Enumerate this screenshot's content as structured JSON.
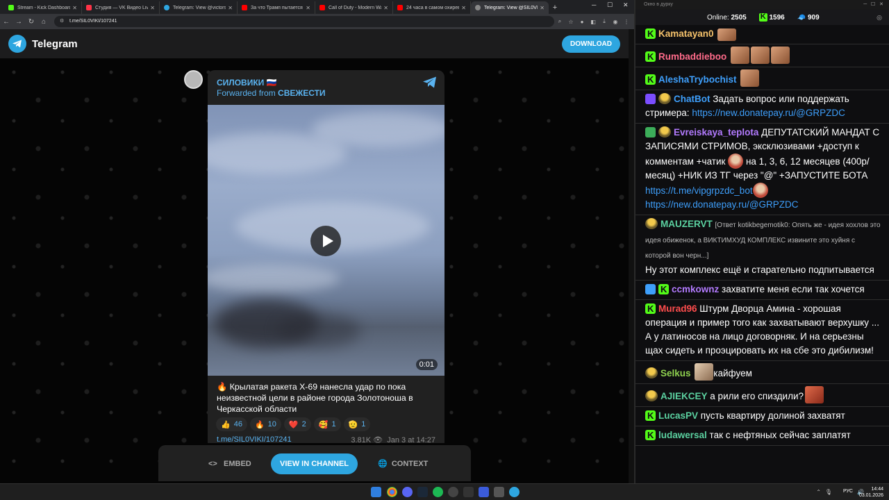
{
  "browser": {
    "tabs": [
      {
        "title": "Stream - Kick Dashboard",
        "icon": "kick-icon",
        "color": "#53fc18",
        "active": false
      },
      {
        "title": "Студия — VK Видео Live",
        "icon": "vk-video-icon",
        "color": "#ff3347",
        "active": false
      },
      {
        "title": "Telegram: View @victorstep…",
        "icon": "telegram-icon",
        "color": "#2ea6e0",
        "active": false
      },
      {
        "title": "За что Трамп пытается уби…",
        "icon": "youtube-icon",
        "color": "#ff0000",
        "active": false
      },
      {
        "title": "Call of Duty - Modern Warfa…",
        "icon": "youtube-icon",
        "color": "#ff0000",
        "active": false
      },
      {
        "title": "24 часа в самом охиревш…",
        "icon": "youtube-icon",
        "color": "#ff0000",
        "active": false
      },
      {
        "title": "Telegram: View @SIL0VIKI",
        "icon": "telegram-icon",
        "color": "#2ea6e0",
        "active": true
      }
    ],
    "url": "t.me/SIL0VIKI/107241"
  },
  "telegram": {
    "brand": "Telegram",
    "download_label": "DOWNLOAD",
    "channel_name": "СИЛОВИКИ 🇷🇺",
    "forwarded_prefix": "Forwarded from",
    "forwarded_source": "СВЕЖЕСТИ",
    "video_duration": "0:01",
    "post_text": "🔥 Крылатая ракета Х-69 нанесла удар по пока неизвестной цели в районе города Золотоноша в Черкасской области",
    "reactions": [
      {
        "emoji": "👍",
        "count": "46"
      },
      {
        "emoji": "🔥",
        "count": "10"
      },
      {
        "emoji": "❤️",
        "count": "2"
      },
      {
        "emoji": "🥰",
        "count": "1"
      },
      {
        "emoji": "🫡",
        "count": "1"
      }
    ],
    "post_link": "t.me/SIL0VIKI/107241",
    "views": "3.81K",
    "date": "Jan 3 at 14:27",
    "embed_label": "EMBED",
    "view_in_channel_label": "VIEW IN CHANNEL",
    "context_label": "CONTEXT"
  },
  "chat": {
    "window_title": "Окно в дурку",
    "online_label": "Online:",
    "online_count": "2505",
    "kick_viewers": "1596",
    "other_viewers": "909",
    "colors": {
      "kick": "#53fc18",
      "link": "#3e9ffb"
    },
    "messages": [
      {
        "user": "Kamatayan0",
        "color": "#f5c26b",
        "text": ""
      },
      {
        "user": "Rumbaddieboo",
        "color": "#ff6b8a",
        "text": ""
      },
      {
        "user": "AleshaTrybochist",
        "color": "#3e9ffb",
        "text": ""
      },
      {
        "user": "ChatBot",
        "color": "#3e9ffb",
        "text": "Задать вопрос или поддержать стримера:",
        "link": "https://new.donatepay.ru/@GRPZDC"
      },
      {
        "user": "Evreiskaya_teplota",
        "color": "#b37bff",
        "text": "ДЕПУТАТСКИЙ МАНДАТ С ЗАПИСЯМИ СТРИМОВ, эксклюзивами +доступ к комментам +чатик",
        "text2": "на 1, 3, 6, 12 месяцев (400р/месяц) +НИК ИЗ ТГ через \"@\" +ЗАПУСТИТЕ БОТА",
        "link": "https://t.me/vipgrpzdc_bot",
        "link2": "https://new.donatepay.ru/@GRPZDC"
      },
      {
        "user": "MAUZERVT",
        "color": "#5bd1a0",
        "reply": "[Ответ kotikbegemotik0: Опять же - идея хохлов это идея обиженок, а ВИКТИМХУД КОМПЛЕКС извините это хуйня с которой вон черн...]",
        "text": "Ну этот комплекс ещё и старательно подпитывается"
      },
      {
        "user": "ccmkownz",
        "color": "#b37bff",
        "text": "захватите меня если так хочется"
      },
      {
        "user": "Murad96",
        "color": "#ff4d4d",
        "text": "Штурм Дворца Амина - хорошая операция и пример того как захватывают верхушку ... А у латиносов на лицо договорняк. И на серьезны щах сидеть и проэцировать их на сбе это дибилизм!"
      },
      {
        "user": "Selkus",
        "color": "#8fd14f",
        "text": "кайфуем"
      },
      {
        "user": "AJIEKCEY",
        "color": "#5bd1a0",
        "text": "а рили его спиздили?"
      },
      {
        "user": "LucasPV",
        "color": "#5bd1a0",
        "text": "пусть квартиру долиной захватят"
      },
      {
        "user": "ludawersal",
        "color": "#5bd1a0",
        "text": "так с нефтяных сейчас заплатят"
      }
    ]
  },
  "taskbar": {
    "lang": "РУС",
    "time": "14:44",
    "date": "03.01.2026"
  }
}
